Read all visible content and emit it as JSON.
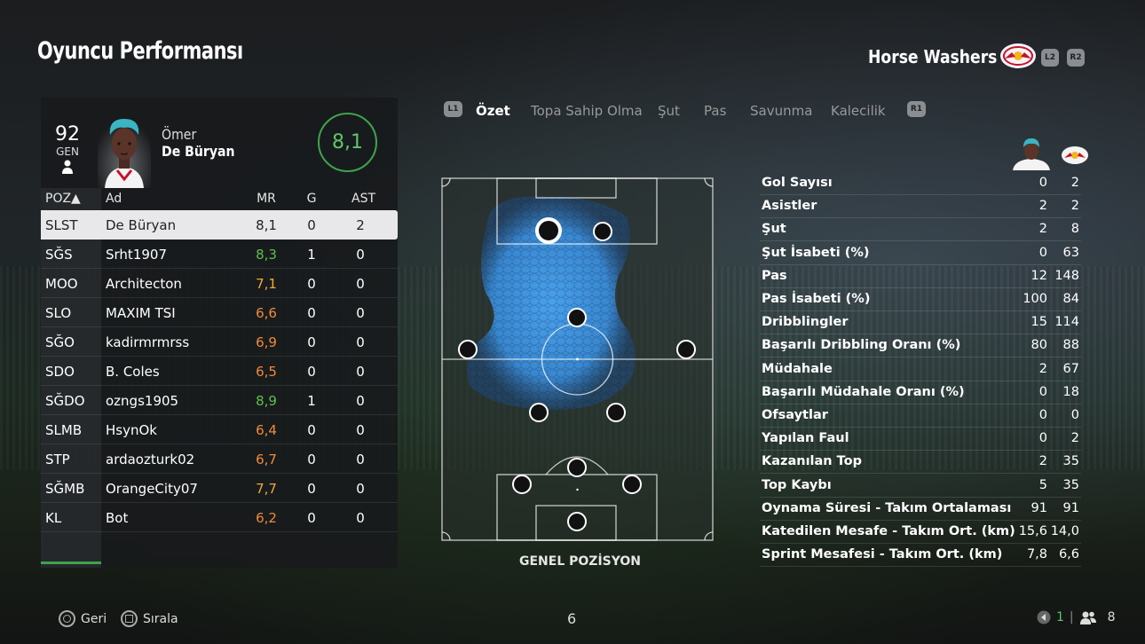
{
  "header": {
    "title": "Oyuncu Performansı",
    "team_name": "Horse Washers",
    "btn_l2": "L2",
    "btn_r2": "R2"
  },
  "player": {
    "overall": "92",
    "overall_label": "GEN",
    "first_name": "Ömer",
    "last_name": "De Büryan",
    "match_rating": "8,1"
  },
  "table": {
    "headers": {
      "pos": "POZ▲",
      "name": "Ad",
      "mr": "MR",
      "g": "G",
      "ast": "AST"
    },
    "rows": [
      {
        "pos": "SLST",
        "name": "De Büryan",
        "mr": "8,1",
        "g": "0",
        "ast": "2",
        "color": "#222222"
      },
      {
        "pos": "SĞS",
        "name": "Srht1907",
        "mr": "8,3",
        "g": "1",
        "ast": "0",
        "color": "#5fbf4a"
      },
      {
        "pos": "MOO",
        "name": "Architecton",
        "mr": "7,1",
        "g": "0",
        "ast": "0",
        "color": "#f0a93a"
      },
      {
        "pos": "SLO",
        "name": "MAXIM TSI",
        "mr": "6,6",
        "g": "0",
        "ast": "0",
        "color": "#f08a3a"
      },
      {
        "pos": "SĞO",
        "name": "kadirmrmrss",
        "mr": "6,9",
        "g": "0",
        "ast": "0",
        "color": "#f08a3a"
      },
      {
        "pos": "SDO",
        "name": "B. Coles",
        "mr": "6,5",
        "g": "0",
        "ast": "0",
        "color": "#f08a3a"
      },
      {
        "pos": "SĞDO",
        "name": "ozngs1905",
        "mr": "8,9",
        "g": "1",
        "ast": "0",
        "color": "#5fbf4a"
      },
      {
        "pos": "SLMB",
        "name": "HsynOk",
        "mr": "6,4",
        "g": "0",
        "ast": "0",
        "color": "#f08a3a"
      },
      {
        "pos": "STP",
        "name": "ardaozturk02",
        "mr": "6,7",
        "g": "0",
        "ast": "0",
        "color": "#f08a3a"
      },
      {
        "pos": "SĞMB",
        "name": "OrangeCity07",
        "mr": "7,7",
        "g": "0",
        "ast": "0",
        "color": "#f0a93a"
      },
      {
        "pos": "KL",
        "name": "Bot",
        "mr": "6,2",
        "g": "0",
        "ast": "0",
        "color": "#f08a3a"
      }
    ]
  },
  "tabs": {
    "left_btn": "L1",
    "right_btn": "R1",
    "items": [
      "Özet",
      "Topa Sahip Olma",
      "Şut",
      "Pas",
      "Savunma",
      "Kalecilik"
    ],
    "active": 0
  },
  "pitch": {
    "label": "GENEL POZİSYON"
  },
  "stats": [
    {
      "label": "Gol Sayısı",
      "player": "0",
      "team": "2"
    },
    {
      "label": "Asistler",
      "player": "2",
      "team": "2"
    },
    {
      "label": "Şut",
      "player": "2",
      "team": "8"
    },
    {
      "label": "Şut İsabeti (%)",
      "player": "0",
      "team": "63"
    },
    {
      "label": "Pas",
      "player": "12",
      "team": "148"
    },
    {
      "label": "Pas İsabeti (%)",
      "player": "100",
      "team": "84"
    },
    {
      "label": "Dribblingler",
      "player": "15",
      "team": "114"
    },
    {
      "label": "Başarılı Dribbling Oranı (%)",
      "player": "80",
      "team": "88"
    },
    {
      "label": "Müdahale",
      "player": "2",
      "team": "67"
    },
    {
      "label": "Başarılı Müdahale Oranı (%)",
      "player": "0",
      "team": "18"
    },
    {
      "label": "Ofsaytlar",
      "player": "0",
      "team": "0"
    },
    {
      "label": "Yapılan Faul",
      "player": "0",
      "team": "2"
    },
    {
      "label": "Kazanılan Top",
      "player": "2",
      "team": "35"
    },
    {
      "label": "Top Kaybı",
      "player": "5",
      "team": "35"
    },
    {
      "label": "Oynama Süresi - Takım Ortalaması",
      "player": "91",
      "team": "91"
    },
    {
      "label": "Katedilen Mesafe - Takım Ort. (km)",
      "player": "15,6",
      "team": "14,0"
    },
    {
      "label": "Sprint Mesafesi - Takım Ort. (km)",
      "player": "7,8",
      "team": "6,6"
    }
  ],
  "footer": {
    "back_label": "Geri",
    "sort_label": "Sırala",
    "page_number": "6",
    "count_green": "1",
    "count_players": "8"
  },
  "colors": {
    "accent_green": "#3ea44c",
    "heatmap_blue": "#3e9cf0"
  }
}
